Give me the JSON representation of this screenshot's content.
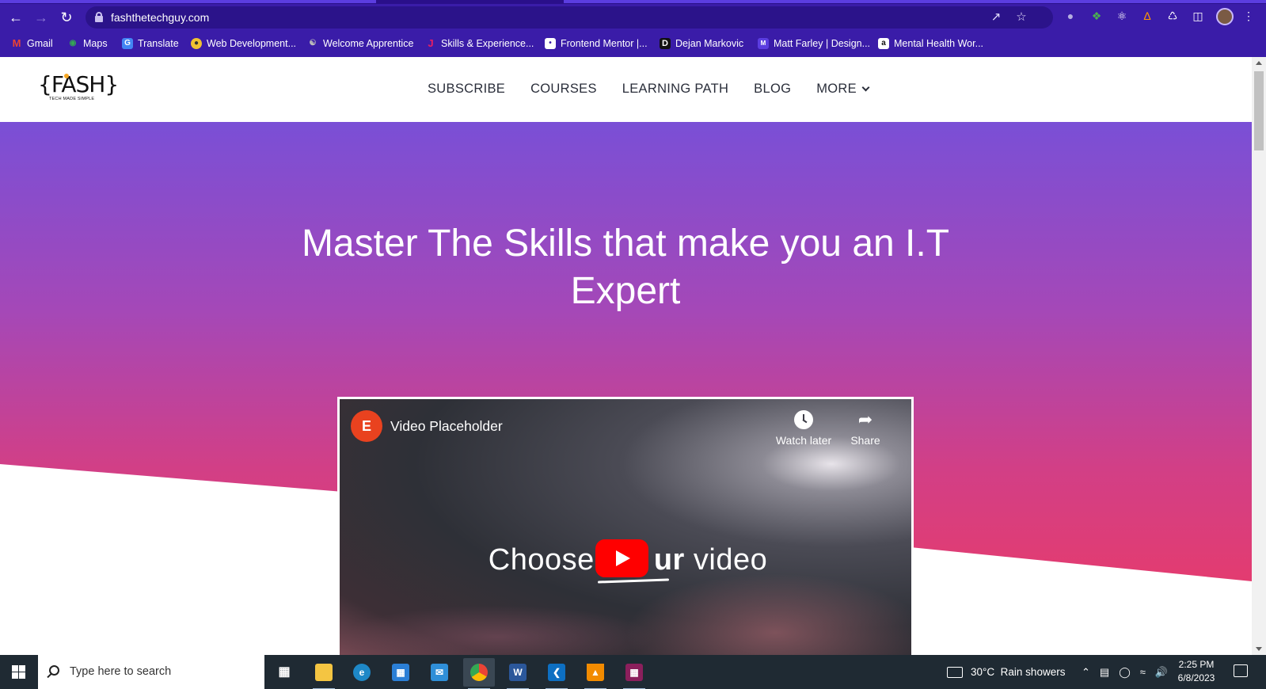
{
  "browser": {
    "url": "fashthetechguy.com",
    "bookmarks": [
      {
        "label": "Gmail",
        "icon": "gmail-icon",
        "color": "#ea4335"
      },
      {
        "label": "Maps",
        "icon": "maps-pin-icon",
        "color": "#34a853"
      },
      {
        "label": "Translate",
        "icon": "translate-icon",
        "color": "#4285f4"
      },
      {
        "label": "Web Development...",
        "icon": "web-dev-icon",
        "color": "#f1c232"
      },
      {
        "label": "Welcome Apprentice",
        "icon": "apprentice-icon",
        "color": "#9b9b9b"
      },
      {
        "label": "Skills & Experience...",
        "icon": "j-logo-icon",
        "color": "#e91e63"
      },
      {
        "label": "Frontend Mentor |...",
        "icon": "frontend-mentor-icon",
        "color": "#ffffff"
      },
      {
        "label": "Dejan Markovic",
        "icon": "d-logo-icon",
        "color": "#111111"
      },
      {
        "label": "Matt Farley | Design...",
        "icon": "mf-logo-icon",
        "color": "#5b3de0"
      },
      {
        "label": "Mental Health Wor...",
        "icon": "amazon-icon",
        "color": "#ffffff"
      }
    ]
  },
  "site": {
    "logo_text": "{FASH}",
    "logo_tagline": "TECH MADE SIMPLE",
    "nav": [
      "SUBSCRIBE",
      "COURSES",
      "LEARNING PATH",
      "BLOG",
      "MORE"
    ]
  },
  "hero": {
    "title": "Master The Skills that make you an I.T Expert"
  },
  "video": {
    "channel_logo": "E",
    "title": "Video Placeholder",
    "watch_later": "Watch later",
    "share": "Share",
    "center_text_pre": "Choose",
    "center_text_bold": "ur",
    "center_text_post": "video"
  },
  "taskbar": {
    "search_placeholder": "Type here to search",
    "weather": "30°C  Rain showers",
    "time": "2:25 PM",
    "date": "6/8/2023"
  }
}
